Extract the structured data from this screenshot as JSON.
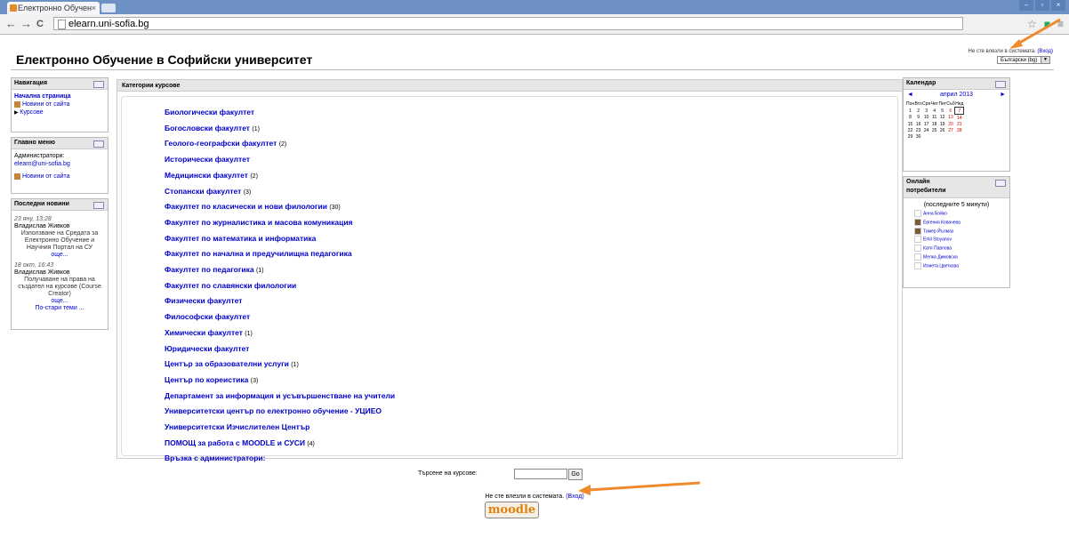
{
  "browser": {
    "tab_title": "Електронно Обучен",
    "tab_close": "×",
    "url": "elearn.uni-sofia.bg",
    "back": "←",
    "forward": "→",
    "reload": "C"
  },
  "header": {
    "title": "Електронно Обучение в Софийски университет",
    "login_text": "Не сте влезли в системата. ",
    "login_link": "(Вход)",
    "language": "Български (bg)"
  },
  "navigation": {
    "title": "Навигация",
    "home": "Начална страница",
    "news": "Новини от сайта",
    "courses": "Курсове"
  },
  "main_menu": {
    "title": "Главно меню",
    "admins_label": "Администратори:",
    "admin_email": "elearn@uni-sofia.bg",
    "news": "Новини от сайта"
  },
  "latest_news": {
    "title": "Последни новини",
    "items": [
      {
        "date": "23 яну, 13:28",
        "author": "Владислав Живков",
        "text": "Използване на Средата за Електронно Обучение и Научния Портал на СУ",
        "more": "още..."
      },
      {
        "date": "18 окт, 16:43",
        "author": "Владислав Живков",
        "text": "Получаване на права на създател на курсове (Course Creator)",
        "more": "още..."
      }
    ],
    "older": "По-стари теми ..."
  },
  "categories": {
    "title": "Категории курсове",
    "items": [
      {
        "name": "Биологически факултет",
        "count": ""
      },
      {
        "name": "Богословски факултет",
        "count": "(1)"
      },
      {
        "name": "Геолого-географски факултет",
        "count": "(2)"
      },
      {
        "name": "Исторически факултет",
        "count": ""
      },
      {
        "name": "Медицински факултет",
        "count": "(2)"
      },
      {
        "name": "Стопански факултет",
        "count": "(3)"
      },
      {
        "name": "Факултет по класически и нови филологии",
        "count": "(30)"
      },
      {
        "name": "Факултет по журналистика и масова комуникация",
        "count": ""
      },
      {
        "name": "Факултет по математика и информатика",
        "count": ""
      },
      {
        "name": "Факултет по начална и предучилищна педагогика",
        "count": ""
      },
      {
        "name": "Факултет по педагогика",
        "count": "(1)"
      },
      {
        "name": "Факултет по славянски филологии",
        "count": ""
      },
      {
        "name": "Физически факултет",
        "count": ""
      },
      {
        "name": "Философски факултет",
        "count": ""
      },
      {
        "name": "Химически факултет",
        "count": "(1)"
      },
      {
        "name": "Юридически факултет",
        "count": ""
      },
      {
        "name": "Център за образователни услуги",
        "count": "(1)"
      },
      {
        "name": "Център по кореистика",
        "count": "(3)"
      },
      {
        "name": "Департамент за информация и усъвършенстване на учители",
        "count": ""
      },
      {
        "name": "Университетски център по електронно обучение - УЦИЕО",
        "count": ""
      },
      {
        "name": "Университетски Изчислителен Център",
        "count": ""
      },
      {
        "name": "ПОМОЩ за работа с MOODLE и СУСИ",
        "count": "(4)"
      },
      {
        "name": "Връзка с администратори:",
        "count": ""
      }
    ]
  },
  "search": {
    "label": "Търсене на курсове:",
    "go": "Go"
  },
  "footer": {
    "login_text": "Не сте влезли в системата. ",
    "login_link": "(Вход)",
    "logo": "moodle"
  },
  "calendar": {
    "title": "Календар",
    "month": "април 2013",
    "prev": "◄",
    "next": "►",
    "weekdays": [
      "Пон",
      "Вто",
      "Сря",
      "Чет",
      "Пет",
      "Съб",
      "Нед"
    ],
    "weeks": [
      [
        "1",
        "2",
        "3",
        "4",
        "5",
        "6",
        "7"
      ],
      [
        "8",
        "9",
        "10",
        "11",
        "12",
        "13",
        "14"
      ],
      [
        "15",
        "16",
        "17",
        "18",
        "19",
        "20",
        "21"
      ],
      [
        "22",
        "23",
        "24",
        "25",
        "26",
        "27",
        "28"
      ],
      [
        "29",
        "30",
        "",
        "",
        "",
        "",
        ""
      ]
    ],
    "today": "7"
  },
  "online_users": {
    "title": "Онлайн потребители",
    "subtitle": "(последните 5 минути)",
    "users": [
      "Анна Бойко",
      "Евгения Ковачева",
      "Тамер Йълмаз",
      "Emil Stoyanov",
      "Катя Павлова",
      "Мелка Димовска",
      "Илиета Цветкова"
    ]
  },
  "colors": {
    "link": "#0000cc",
    "block_header": "#e6e6e6",
    "arrow": "#f08a2c"
  }
}
